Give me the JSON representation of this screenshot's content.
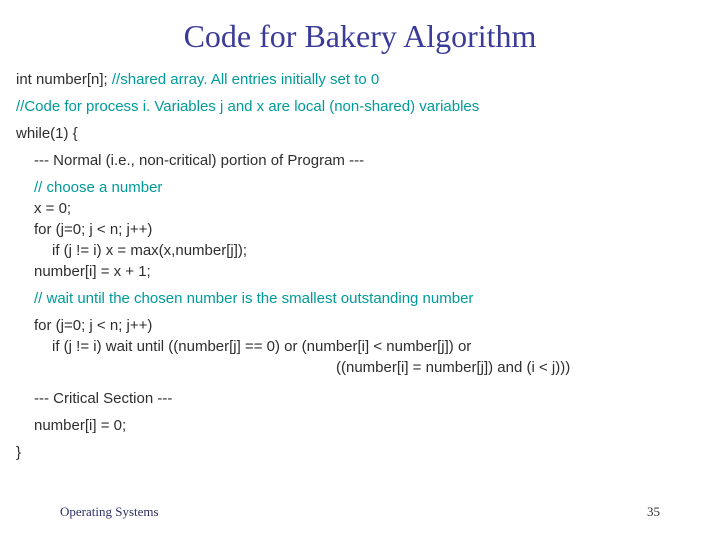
{
  "title": "Code for Bakery Algorithm",
  "lines": {
    "l1a": "int number[n];  ",
    "l1b": "//shared array.  All entries initially set to 0",
    "l2": "//Code for process i.  Variables  j and x are local (non-shared) variables",
    "l3": "while(1)  {",
    "l4": "--- Normal (i.e., non-critical) portion of Program ---",
    "l5": "// choose a number",
    "l6": "x = 0;",
    "l7": "for (j=0; j < n; j++)",
    "l8": "if (j != i)  x = max(x,number[j]);",
    "l9": "number[i] = x + 1;",
    "l10": "// wait until the chosen number is the smallest outstanding number",
    "l11": "for (j=0; j < n; j++)",
    "l12": "if (j != i) wait until ((number[j] == 0) or (number[i] < number[j]) or",
    "l13": "((number[i] = number[j]) and (i < j)))",
    "l14": "--- Critical Section ---",
    "l15": "number[i] = 0;",
    "l16": "}"
  },
  "footer": {
    "left": "Operating Systems",
    "page": "35"
  }
}
